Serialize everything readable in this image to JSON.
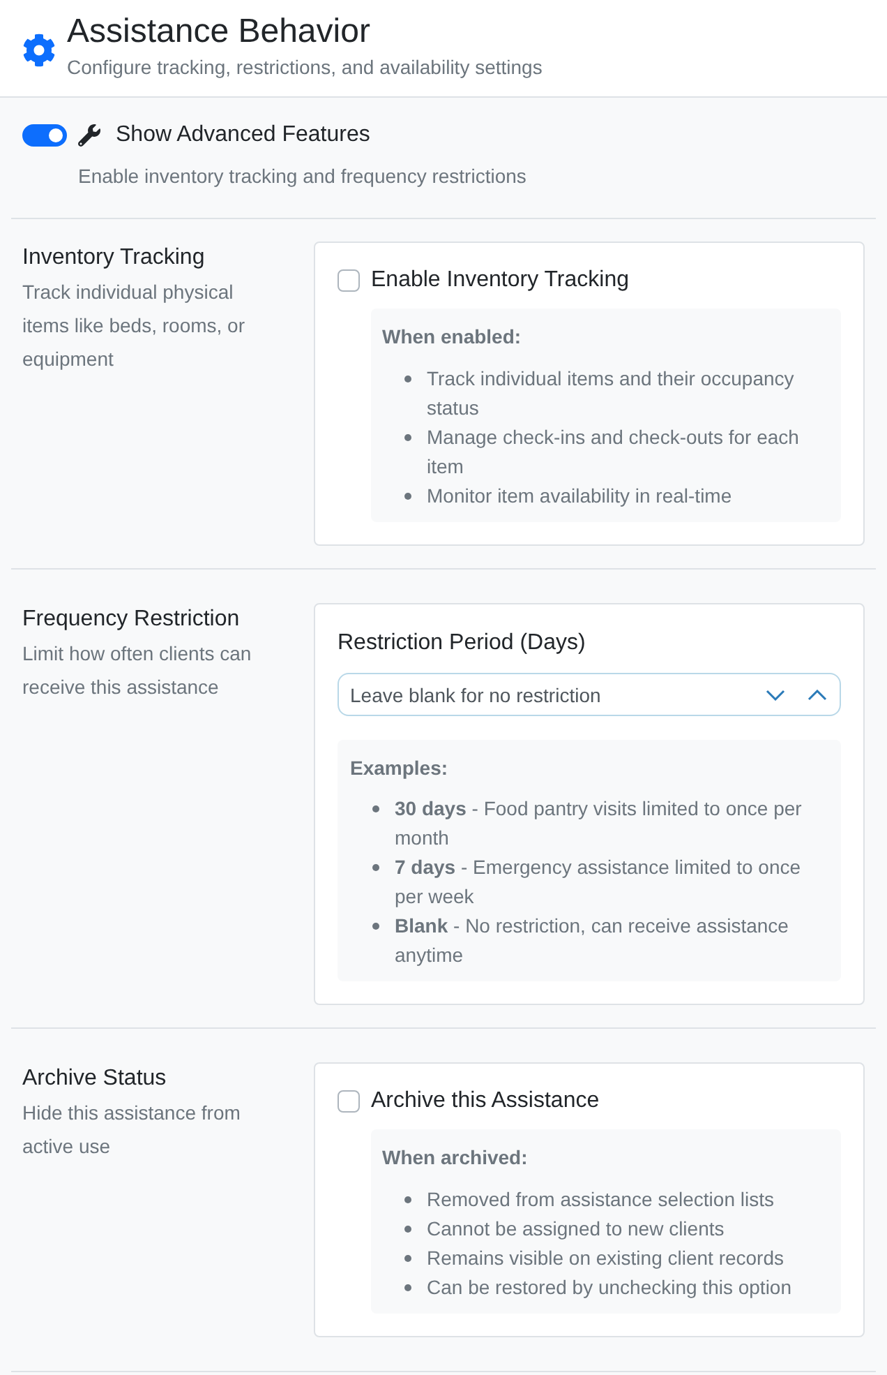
{
  "header": {
    "title": "Assistance Behavior",
    "subtitle": "Configure tracking, restrictions, and availability settings"
  },
  "advanced_toggle": {
    "label": "Show Advanced Features",
    "on": true,
    "description": "Enable inventory tracking and frequency restrictions"
  },
  "sections": [
    {
      "kind": "checkbox",
      "title": "Inventory Tracking",
      "description": "Track individual physical items like beds, rooms, or equipment",
      "checkbox": {
        "label": "Enable Inventory Tracking",
        "checked": false
      },
      "info": {
        "title": "When enabled:",
        "items": [
          "Track individual items and their occupancy status",
          "Manage check-ins and check-outs for each item",
          "Monitor item availability in real-time"
        ]
      }
    },
    {
      "kind": "field",
      "title": "Frequency Restriction",
      "description": "Limit how often clients can receive this assistance",
      "field": {
        "label": "Restriction Period (Days)",
        "placeholder": "Leave blank for no restriction"
      },
      "info": {
        "title": "Examples:",
        "items": [
          "**30 days** - Food pantry visits limited to once per month",
          "**7 days** - Emergency assistance limited to once per week",
          "**Blank** - No restriction, can receive assistance anytime"
        ]
      }
    },
    {
      "kind": "checkbox",
      "title": "Archive Status",
      "description": "Hide this assistance from active use",
      "checkbox": {
        "label": "Archive this Assistance",
        "checked": false
      },
      "info": {
        "title": "When archived:",
        "items": [
          "Removed from assistance selection lists",
          "Cannot be assigned to new clients",
          "Remains visible on existing client records",
          "Can be restored by unchecking this option"
        ]
      }
    }
  ]
}
